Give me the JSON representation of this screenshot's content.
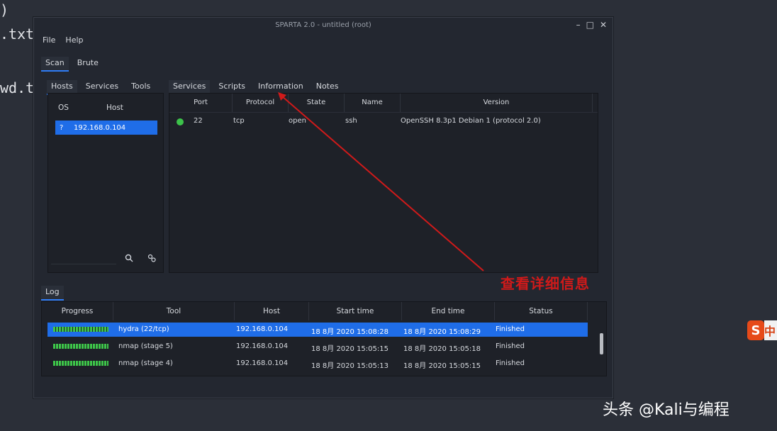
{
  "background": {
    "lines": [
      ")",
      ".txt",
      "wd.t"
    ]
  },
  "window": {
    "title": "SPARTA 2.0 - untitled (root)",
    "controls": [
      "–",
      "□",
      "✕"
    ]
  },
  "menu": [
    "File",
    "Help"
  ],
  "main_tabs": [
    "Scan",
    "Brute"
  ],
  "left_tabs": [
    "Hosts",
    "Services",
    "Tools"
  ],
  "hosts": {
    "columns": [
      "OS",
      "Host"
    ],
    "rows": [
      {
        "os": "?",
        "host": "192.168.0.104"
      }
    ]
  },
  "right_tabs": [
    "Services",
    "Scripts",
    "Information",
    "Notes"
  ],
  "services": {
    "columns": [
      "Port",
      "Protocol",
      "State",
      "Name",
      "Version"
    ],
    "rows": [
      {
        "port": "22",
        "protocol": "tcp",
        "state": "open",
        "name": "ssh",
        "version": "OpenSSH 8.3p1 Debian 1 (protocol 2.0)"
      }
    ]
  },
  "log": {
    "tab": "Log",
    "columns": [
      "Progress",
      "Tool",
      "Host",
      "Start time",
      "End time",
      "Status"
    ],
    "rows": [
      {
        "tool": "hydra (22/tcp)",
        "host": "192.168.0.104",
        "start": "18 8月 2020 15:08:28",
        "end": "18 8月 2020 15:08:29",
        "status": "Finished",
        "progress": 1.0
      },
      {
        "tool": "nmap (stage 5)",
        "host": "192.168.0.104",
        "start": "18 8月 2020 15:05:15",
        "end": "18 8月 2020 15:05:18",
        "status": "Finished",
        "progress": 1.0
      },
      {
        "tool": "nmap (stage 4)",
        "host": "192.168.0.104",
        "start": "18 8月 2020 15:05:13",
        "end": "18 8月 2020 15:05:15",
        "status": "Finished",
        "progress": 1.0
      }
    ]
  },
  "annotation": "查看详细信息",
  "watermark": "头条 @Kali与编程",
  "ime": {
    "logo": "S",
    "tail": "中"
  },
  "colors": {
    "accent": "#1f6de8",
    "annotation": "#d01a1a",
    "progress": "#3ec64a",
    "status_ok": "#3cc24a"
  }
}
